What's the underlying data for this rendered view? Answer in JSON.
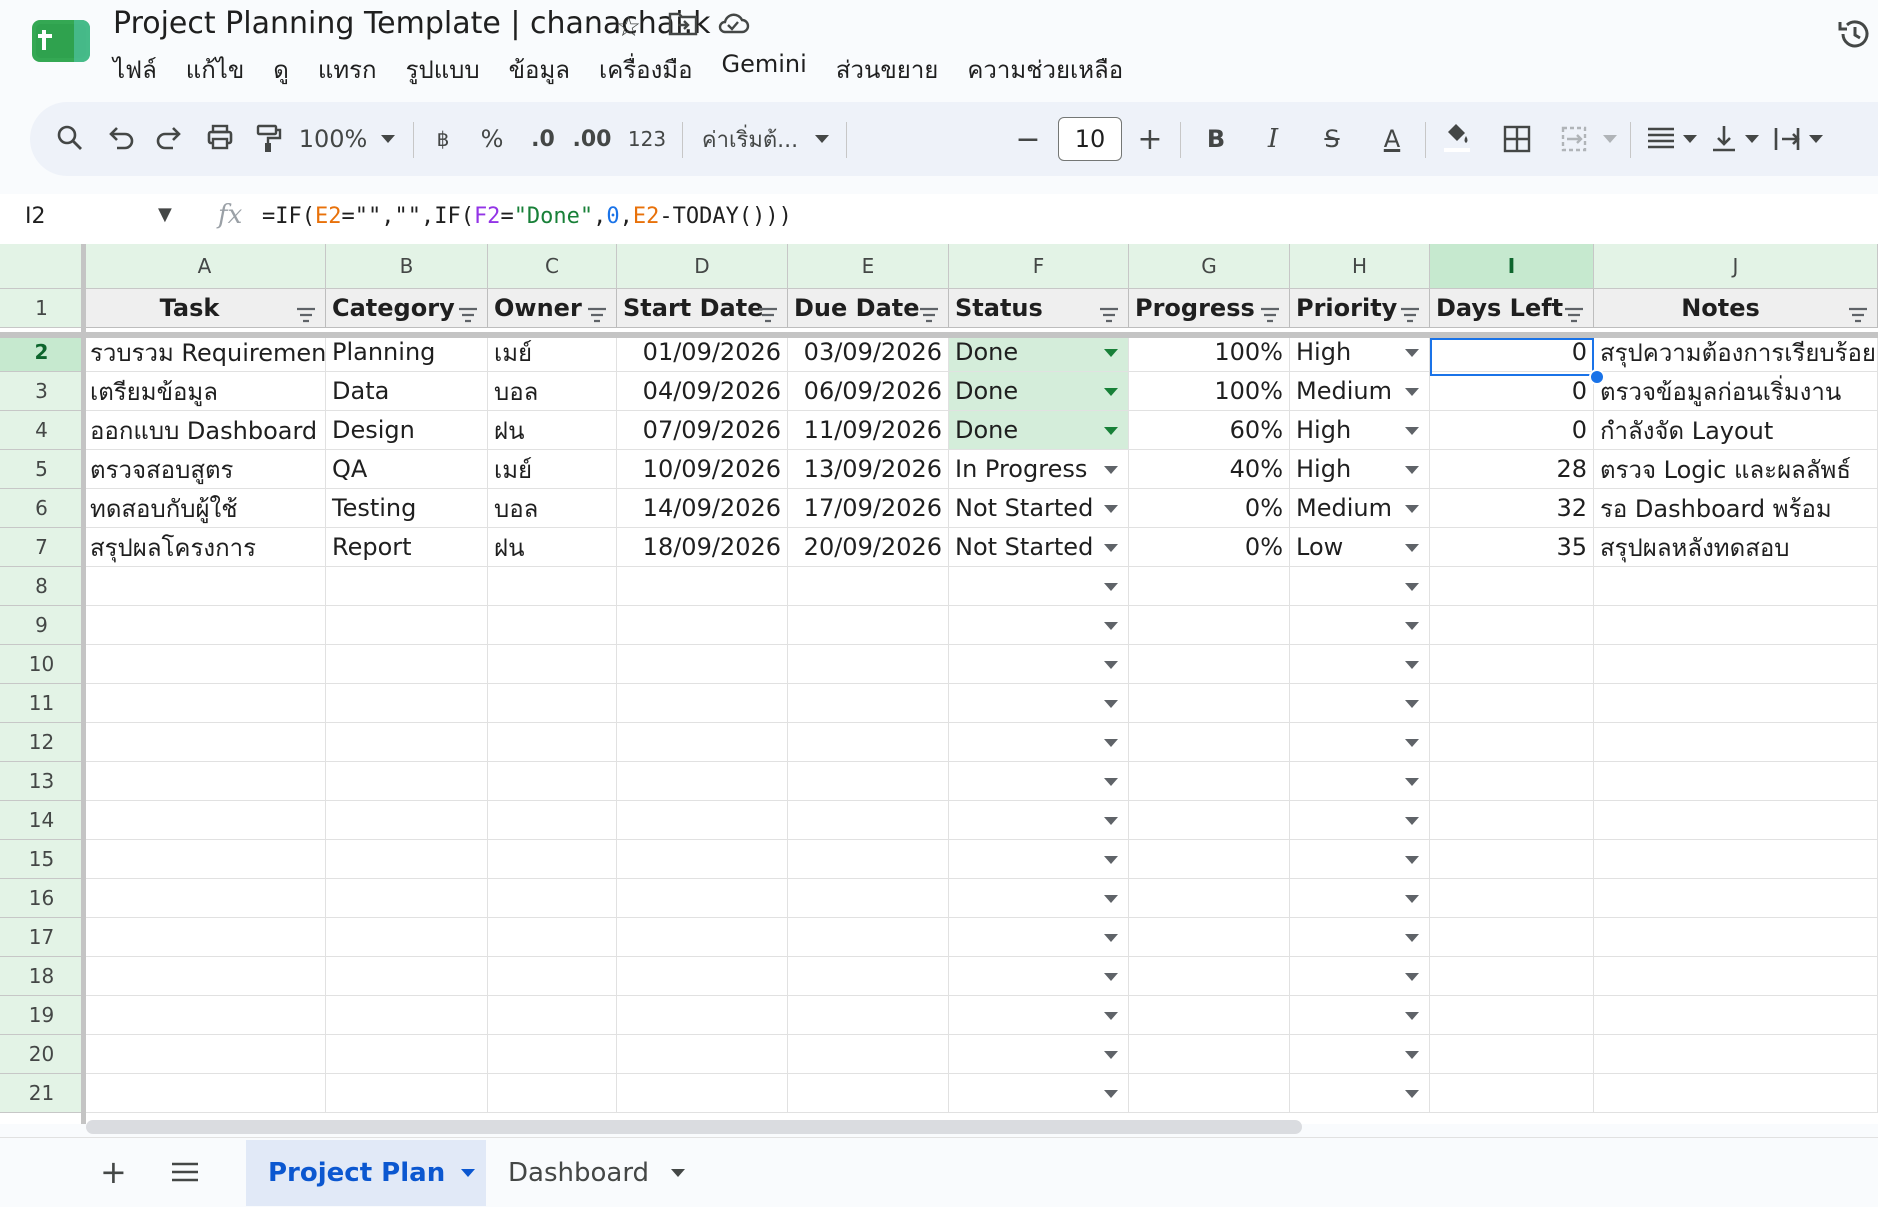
{
  "header": {
    "title": "Project Planning Template | chanachai.k",
    "menu": [
      "ไฟล์",
      "แก้ไข",
      "ดู",
      "แทรก",
      "รูปแบบ",
      "ข้อมูล",
      "เครื่องมือ",
      "Gemini",
      "ส่วนขยาย",
      "ความช่วยเหลือ"
    ]
  },
  "toolbar": {
    "zoom": "100%",
    "currency": "฿",
    "percent": "%",
    "dec_decrease": ".0",
    "dec_increase": ".00",
    "format_number": "123",
    "font": "ค่าเริ่มต้...",
    "font_size": "10",
    "bold": "B",
    "italic": "I",
    "strike": "S",
    "text_color": "A"
  },
  "formula_bar": {
    "cell_ref": "I2",
    "formula_parts": [
      "=IF(",
      "E2",
      "=\"\",\"\",IF(",
      "F2",
      "=",
      "\"Done\"",
      ",",
      "0",
      ",",
      "E2",
      "-TODAY()))"
    ]
  },
  "grid": {
    "columns": [
      "A",
      "B",
      "C",
      "D",
      "E",
      "F",
      "G",
      "H",
      "I",
      "J"
    ],
    "rows": [
      "1",
      "2",
      "3",
      "4",
      "5",
      "6",
      "7",
      "8",
      "9",
      "10",
      "11",
      "12",
      "13",
      "14",
      "15",
      "16",
      "17",
      "18",
      "19",
      "20",
      "21"
    ],
    "headers": [
      "Task",
      "Category",
      "Owner",
      "Start Date",
      "Due Date",
      "Status",
      "Progress",
      "Priority",
      "Days Left",
      "Notes"
    ],
    "data": [
      [
        "รวบรวม Requirement",
        "Planning",
        "เมย์",
        "01/09/2026",
        "03/09/2026",
        "Done",
        "100%",
        "High",
        "0",
        "สรุปความต้องการเรียบร้อย"
      ],
      [
        "เตรียมข้อมูล",
        "Data",
        "บอล",
        "04/09/2026",
        "06/09/2026",
        "Done",
        "100%",
        "Medium",
        "0",
        "ตรวจข้อมูลก่อนเริ่มงาน"
      ],
      [
        "ออกแบบ Dashboard",
        "Design",
        "ฝน",
        "07/09/2026",
        "11/09/2026",
        "Done",
        "60%",
        "High",
        "0",
        "กำลังจัด Layout"
      ],
      [
        "ตรวจสอบสูตร",
        "QA",
        "เมย์",
        "10/09/2026",
        "13/09/2026",
        "In Progress",
        "40%",
        "High",
        "28",
        "ตรวจ Logic และผลลัพธ์"
      ],
      [
        "ทดสอบกับผู้ใช้",
        "Testing",
        "บอล",
        "14/09/2026",
        "17/09/2026",
        "Not Started",
        "0%",
        "Medium",
        "32",
        "รอ Dashboard พร้อม"
      ],
      [
        "สรุปผลโครงการ",
        "Report",
        "ฝน",
        "18/09/2026",
        "20/09/2026",
        "Not Started",
        "0%",
        "Low",
        "35",
        "สรุปผลหลังทดสอบ"
      ]
    ],
    "selected_column": "I",
    "selected_row": "2",
    "done_color": "#d4edda",
    "selection_color": "#1a73e8"
  },
  "sheets": {
    "active": "Project Plan",
    "other": "Dashboard"
  }
}
